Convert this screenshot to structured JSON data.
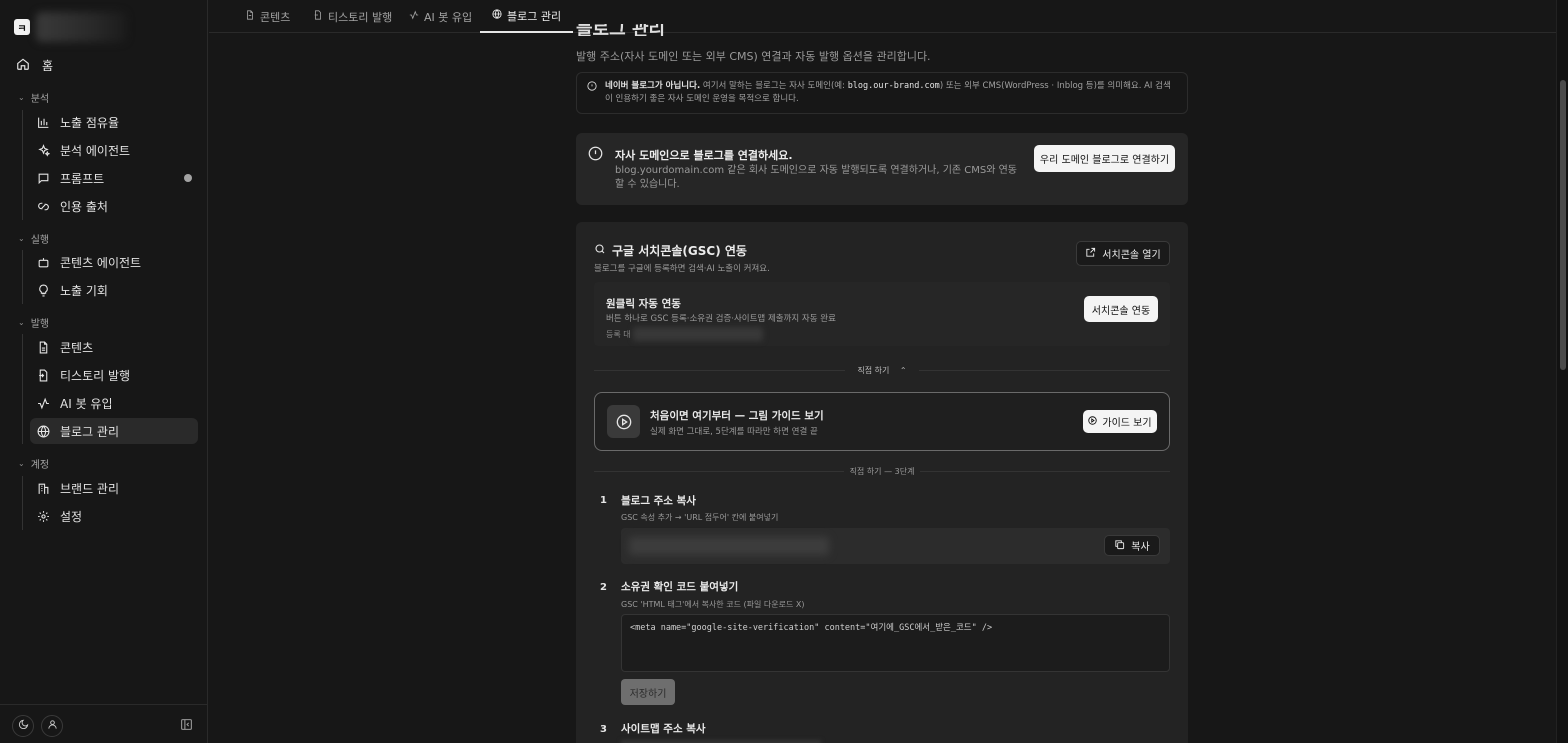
{
  "sidebar": {
    "brand_initial": "ㅋ",
    "home": "홈",
    "groups": {
      "analysis": "분석",
      "execution": "실행",
      "publish": "발행",
      "account": "계정"
    },
    "items": {
      "exposure_share": "노출 점유율",
      "analysis_agent": "분석 에이전트",
      "prompts": "프롬프트",
      "citation_sources": "인용 출처",
      "content_agent": "콘텐츠 에이전트",
      "exposure_opportunity": "노출 기회",
      "contents": "콘텐츠",
      "tistory_publish": "티스토리 발행",
      "ai_bot_inflow": "AI 봇 유입",
      "blog_manage": "블로그 관리",
      "brand_manage": "브랜드 관리",
      "settings": "설정"
    }
  },
  "tabs": [
    "콘텐츠",
    "티스토리 발행",
    "AI 봇 유입",
    "블로그 관리"
  ],
  "page": {
    "title": "블로그 관리",
    "subtitle": "발행 주소(자사 도메인 또는 외부 CMS) 연결과 자동 발행 옵션을 관리합니다.",
    "notice_bold": "네이버 블로그가 아닙니다.",
    "notice_pre": " 여기서 말하는 블로그는 자사 도메인(예: ",
    "notice_code": "blog.our-brand.com",
    "notice_post": ") 또는 외부 CMS(WordPress · Inblog 등)를 의미해요. AI 검색이 인용하기 좋은 자사 도메인 운영을 목적으로 합니다."
  },
  "connect": {
    "title": "자사 도메인으로 블로그를 연결하세요.",
    "desc": "blog.yourdomain.com 같은 회사 도메인으로 자동 발행되도록 연결하거나, 기존 CMS와 연동할 수 있습니다.",
    "button": "우리 도메인 블로그로 연결하기"
  },
  "gsc": {
    "title": "구글 서치콘솔(GSC) 연동",
    "subtitle": "블로그를 구글에 등록하면 검색·AI 노출이 커져요.",
    "open_button": "서치콘솔 열기",
    "oneclick_title": "원클릭 자동 연동",
    "oneclick_desc": "버튼 하나로 GSC 등록·소유권 검증·사이트맵 제출까지 자동 완료",
    "oneclick_status": "등록 대",
    "connect_button": "서치콘솔 연동",
    "direct_toggle": "직접 하기",
    "guide_title": "처음이면 여기부터 — 그림 가이드 보기",
    "guide_sub": "실제 화면 그대로, 5단계를 따라만 하면 연결 끝",
    "guide_button": "가이드 보기",
    "steps_label": "직접 하기 — 3단계",
    "steps": [
      {
        "num": "1",
        "title": "블로그 주소 복사",
        "sub": "GSC 속성 추가 → 'URL 접두어' 칸에 붙여넣기"
      },
      {
        "num": "2",
        "title": "소유권 확인 코드 붙여넣기",
        "sub": "GSC 'HTML 태그'에서 복사한 코드 (파일 다운로드 X)"
      },
      {
        "num": "3",
        "title": "사이트맵 주소 복사",
        "sub": ""
      }
    ],
    "copy_button": "복사",
    "code_placeholder": "<meta name=\"google-site-verification\" content=\"여기에_GSC에서_받은_코드\" />",
    "save_button": "저장하기"
  }
}
